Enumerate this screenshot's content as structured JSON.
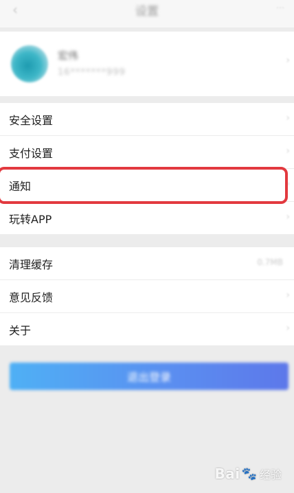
{
  "navbar": {
    "title": "设置",
    "back_icon": "chevron-left-icon",
    "more_icon": "more-icon"
  },
  "profile": {
    "name": "宏伟",
    "phone": "16*******999",
    "avatar_icon": "avatar",
    "chevron_icon": "chevron-right-icon"
  },
  "group1": {
    "items": [
      {
        "label": "安全设置"
      },
      {
        "label": "支付设置"
      },
      {
        "label": "通知"
      },
      {
        "label": "玩转APP"
      }
    ]
  },
  "group2": {
    "items": [
      {
        "label": "清理缓存",
        "value": "0.7MB"
      },
      {
        "label": "意见反馈"
      },
      {
        "label": "关于"
      }
    ]
  },
  "logout": {
    "label": "退出登录"
  },
  "watermark": {
    "brand": "Bai",
    "text": "经验"
  },
  "colors": {
    "highlight": "#e2393f",
    "button_gradient_start": "#4fb0f5",
    "button_gradient_end": "#5d78ea",
    "page_background": "#ececec"
  }
}
